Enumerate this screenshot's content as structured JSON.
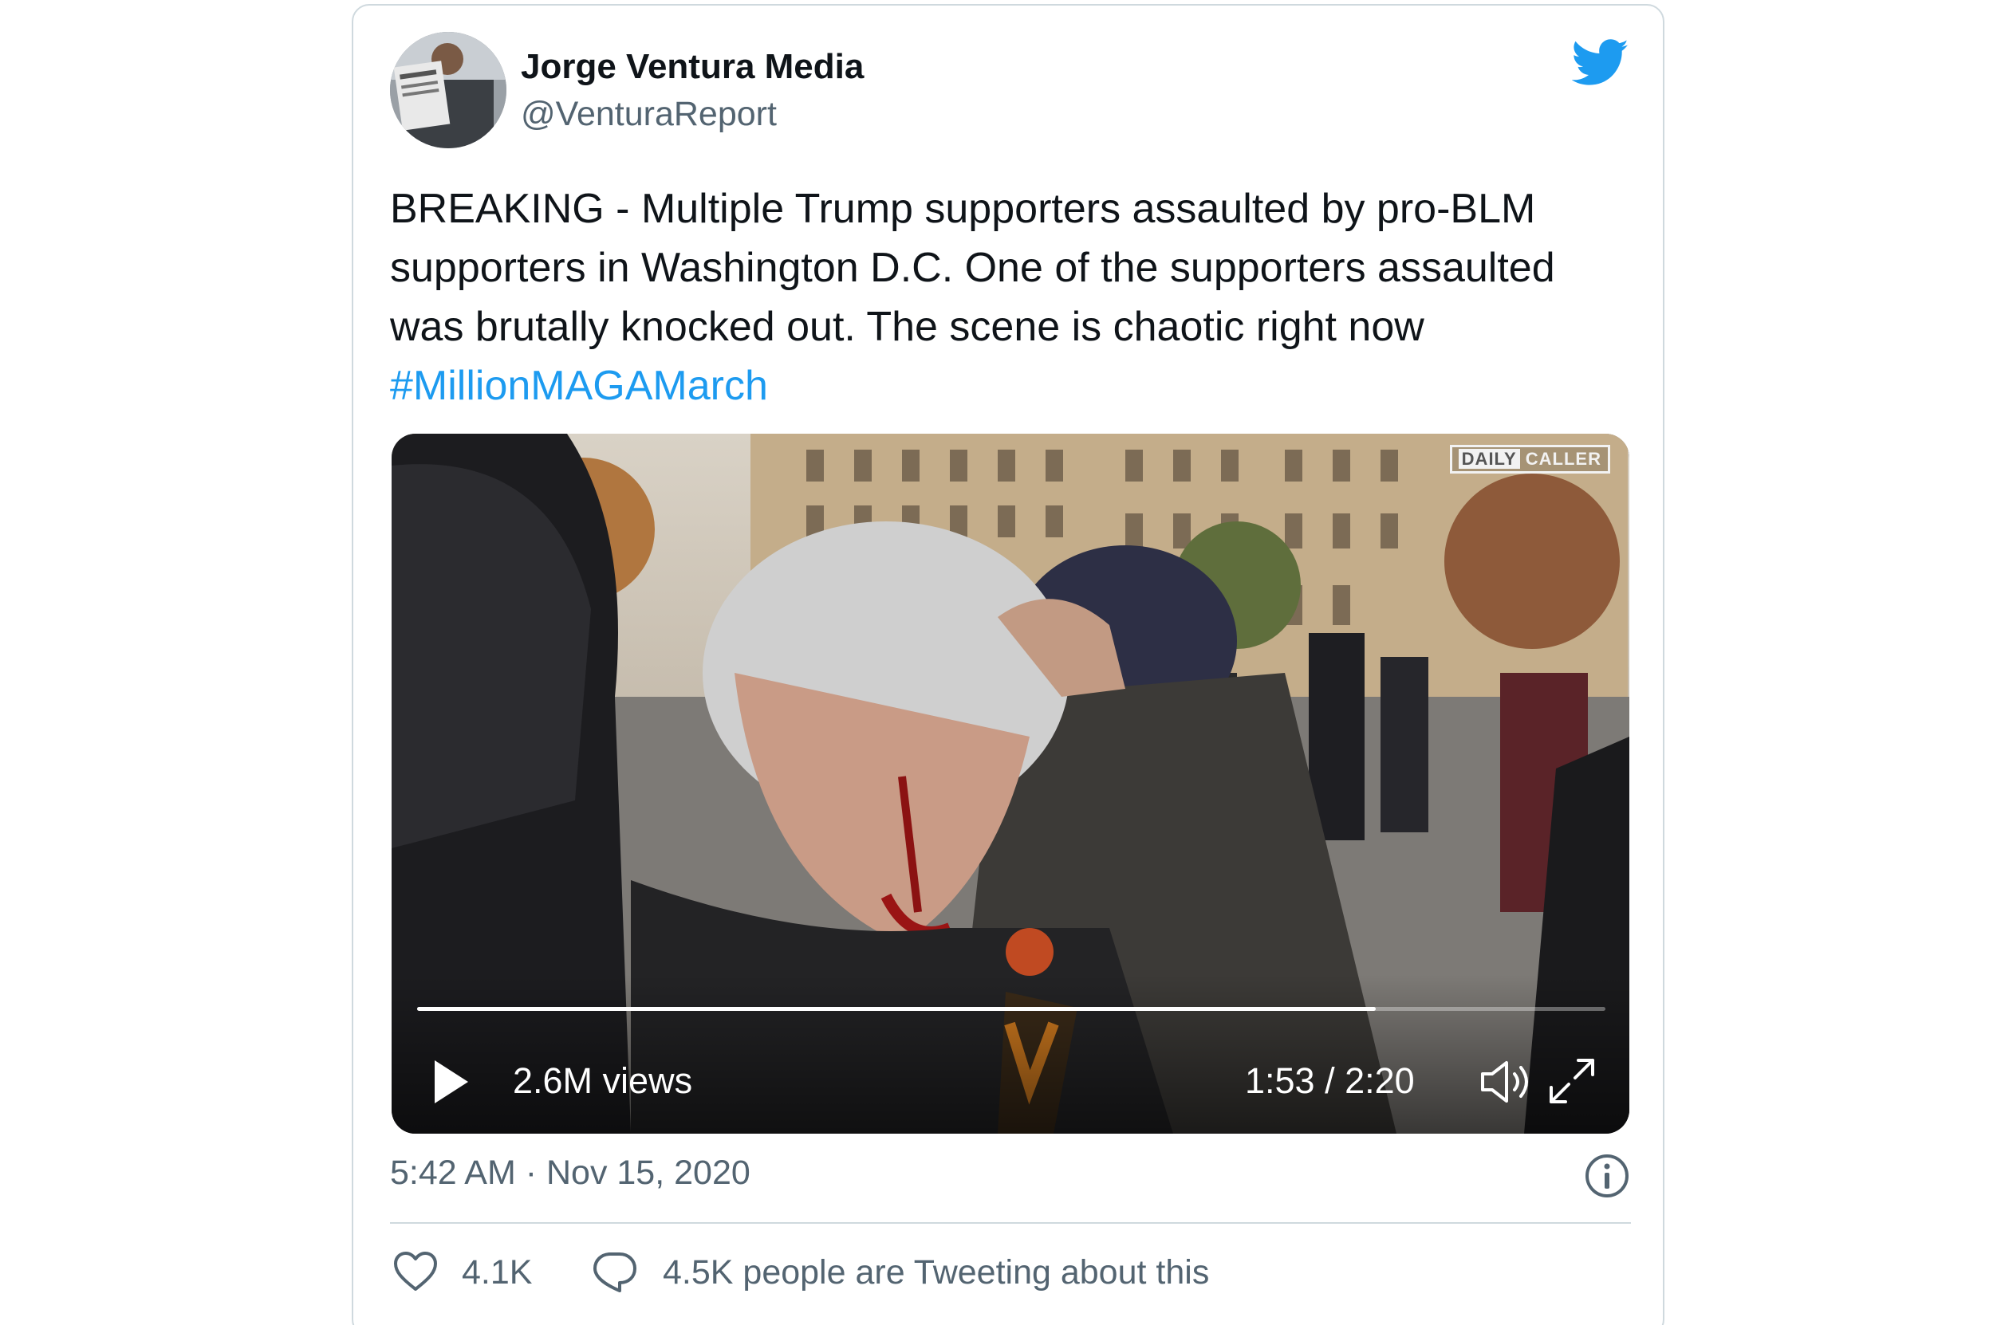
{
  "author": {
    "name": "Jorge Ventura Media",
    "handle": "@VenturaReport"
  },
  "tweet": {
    "text": "BREAKING - Multiple Trump supporters assaulted by pro-BLM supporters in Washington D.C. One of the supporters assaulted was brutally knocked out. The scene is chaotic right now",
    "hashtag": "#MillionMAGAMarch"
  },
  "video": {
    "watermark_part1": "DAILY",
    "watermark_part2": "CALLER",
    "views": "2.6M views",
    "time": "1:53 / 2:20",
    "progress": 0.807
  },
  "footer": {
    "timestamp": "5:42 AM · Nov 15, 2020",
    "likes": "4.1K",
    "conversation": "4.5K people are Tweeting about this"
  },
  "colors": {
    "brand": "#1d9bf0",
    "text": "#0f1419",
    "muted": "#536471",
    "border": "#cfd9de"
  },
  "icons": {
    "logo": "twitter-bird-icon",
    "play": "play-icon",
    "volume": "volume-icon",
    "fullscreen": "fullscreen-icon",
    "info": "info-icon",
    "like": "heart-icon",
    "reply": "speech-bubble-icon"
  }
}
